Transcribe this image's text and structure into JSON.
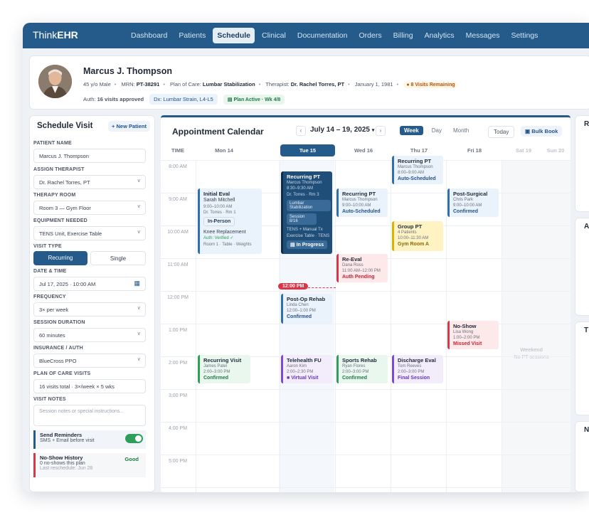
{
  "app": {
    "brand_light": "Think",
    "brand_bold": "EHR"
  },
  "nav": [
    "Dashboard",
    "Patients",
    "Schedule",
    "Clinical",
    "Documentation",
    "Orders",
    "Billing",
    "Analytics",
    "Messages",
    "Settings"
  ],
  "nav_active": "Schedule",
  "patient": {
    "name": "Marcus J. Thompson",
    "age_sex": "45 y/o Male",
    "mrn_label": "MRN:",
    "mrn": "PT-38291",
    "poc_label": "Plan of Care:",
    "poc": "Lumbar Stabilization",
    "therapist_label": "Therapist:",
    "therapist": "Dr. Rachel Torres, PT",
    "dob": "January 1, 1981",
    "visits_remaining": "8 Visits Remaining",
    "auth_label": "Auth:",
    "auth": "16 visits approved",
    "dx": "Dx: Lumbar Strain, L4-L5",
    "plan_status": "Plan Active · Wk 4/8"
  },
  "form": {
    "title": "Schedule Visit",
    "new_patient": "+ New Patient",
    "patient_name_label": "PATIENT NAME",
    "patient_name": "Marcus J. Thompson",
    "therapist_label": "ASSIGN THERAPIST",
    "therapist": "Dr. Rachel Torres, PT",
    "room_label": "THERAPY ROOM",
    "room": "Room 3 — Gym Floor",
    "equipment_label": "EQUIPMENT NEEDED",
    "equipment": "TENS Unit, Exercise Table",
    "visit_type_label": "VISIT TYPE",
    "visit_type_on": "Recurring",
    "visit_type_off": "Single",
    "datetime_label": "DATE & TIME",
    "datetime": "Jul 17, 2025 · 10:00 AM",
    "frequency_label": "FREQUENCY",
    "frequency": "3× per week",
    "duration_label": "SESSION DURATION",
    "duration": "60 minutes",
    "insurance_label": "INSURANCE / AUTH",
    "insurance": "BlueCross PPO",
    "poc_visits_label": "PLAN OF CARE VISITS",
    "poc_visits": "16 visits total · 3×/week × 5 wks",
    "notes_label": "VISIT NOTES",
    "notes_placeholder": "Session notes or special instructions...",
    "reminders_title": "Send Reminders",
    "reminders_sub": "SMS + Email before visit",
    "reminders_on": true,
    "noshow_title": "No-Show History",
    "noshow_status": "Good",
    "noshow_line1": "0 no-shows this plan",
    "noshow_line2": "Last reschedule: Jun 28"
  },
  "calendar": {
    "title": "Appointment Calendar",
    "range": "July 14 – 19, 2025",
    "views": [
      "Week",
      "Day",
      "Month"
    ],
    "active_view": "Week",
    "today": "Today",
    "bulk": "Bulk Book",
    "time_header": "TIME",
    "days": [
      "Mon 14",
      "Tue 15",
      "Wed 16",
      "Thu 17",
      "Fri 18",
      "Sat 19",
      "Sun 20"
    ],
    "selected_day": "Tue 15",
    "times": [
      "8:00 AM",
      "9:00 AM",
      "10:00 AM",
      "11:00 AM",
      "12:00 PM",
      "1:00 PM",
      "2:00 PM",
      "3:00 PM",
      "4:00 PM",
      "5:00 PM"
    ],
    "now": "12:00 PM",
    "weekend_title": "Weekend",
    "weekend_sub": "No PT sessions",
    "events": {
      "mon_initial": {
        "title": "Initial Eval",
        "patient": "Sarah Mitchell",
        "time": "9:00–10:00 AM",
        "therapist": "Dr. Torres · Rm 1",
        "chip": "In-Person",
        "body": "Knee Replacement",
        "auth": "Auth: Verified ✓",
        "room": "Room 1 · Table · Weights"
      },
      "mon_recurring": {
        "title": "Recurring Visit",
        "patient": "James Patel",
        "time": "2:00–3:00 PM",
        "status": "Confirmed"
      },
      "tue_recurring": {
        "title": "Recurring PT",
        "patient": "Marcus Thompson",
        "time": "8:30–9:30 AM",
        "room": "Dr. Torres · Rm 3",
        "chip1": "Lumbar Stabilization",
        "chip2": "Session 8/16",
        "extra1": "TENS + Manual Tx",
        "extra2": "Exercise Table · TENS",
        "status": "In Progress"
      },
      "tue_postop": {
        "title": "Post-Op Rehab",
        "patient": "Linda Chen",
        "time": "12:00–1:00 PM",
        "status": "Confirmed"
      },
      "tue_telehealth": {
        "title": "Telehealth FU",
        "patient": "Aaron Kim",
        "time": "2:00–2:30 PM",
        "status": "Virtual Visit"
      },
      "wed_recurring": {
        "title": "Recurring PT",
        "patient": "Marcus Thompson",
        "time": "9:00–10:00 AM",
        "status": "Auto-Scheduled"
      },
      "wed_reeval": {
        "title": "Re-Eval",
        "patient": "Dana Ross",
        "time": "11:00 AM–12:00 PM",
        "status": "Auth Pending"
      },
      "wed_sports": {
        "title": "Sports Rehab",
        "patient": "Ryan Flores",
        "time": "2:00–3:00 PM",
        "status": "Confirmed"
      },
      "thu_recurring": {
        "title": "Recurring PT",
        "patient": "Marcus Thompson",
        "time": "8:00–9:00 AM",
        "status": "Auto-Scheduled"
      },
      "thu_group": {
        "title": "Group PT",
        "patient": "4 Patients",
        "time": "10:00–11:30 AM",
        "status": "Gym Room A"
      },
      "thu_discharge": {
        "title": "Discharge Eval",
        "patient": "Tom Reeves",
        "time": "2:00–3:00 PM",
        "status": "Final Session"
      },
      "fri_postsurg": {
        "title": "Post-Surgical",
        "patient": "Chris Park",
        "time": "9:00–10:00 AM",
        "status": "Confirmed"
      },
      "fri_noshow": {
        "title": "No-Show",
        "patient": "Lisa Wong",
        "time": "1:00–2:00 PM",
        "status": "Missed Visit"
      }
    }
  },
  "right_panels": [
    "R",
    "A",
    "T",
    "N"
  ]
}
